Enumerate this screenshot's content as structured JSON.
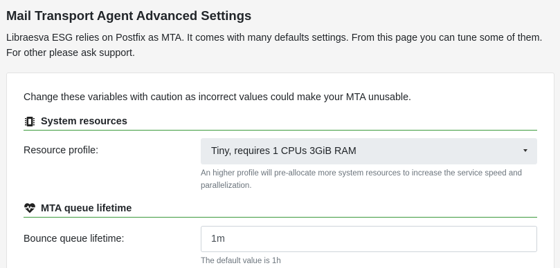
{
  "page": {
    "title": "Mail Transport Agent Advanced Settings",
    "description": "Libraesva ESG relies on Postfix as MTA. It comes with many defaults settings. From this page you can tune some of them. For other please ask support."
  },
  "card": {
    "warning": "Change these variables with caution as incorrect values could make your MTA unusable.",
    "system_resources": {
      "title": "System resources",
      "icon": "chip-icon",
      "resource_profile_label": "Resource profile:",
      "resource_profile_value": "Tiny, requires 1 CPUs 3GiB RAM",
      "resource_profile_help": "An higher profile will pre-allocate more system resources to increase the service speed and parallelization."
    },
    "queue_lifetime": {
      "title": "MTA queue lifetime",
      "icon": "heartbeat-icon",
      "bounce_label": "Bounce queue lifetime:",
      "bounce_value": "1m",
      "bounce_help": "The default value is 1h"
    }
  },
  "colors": {
    "section_rule": "#3c9a3c",
    "select_bg": "#e9ecef",
    "help_text": "#6c757d"
  }
}
